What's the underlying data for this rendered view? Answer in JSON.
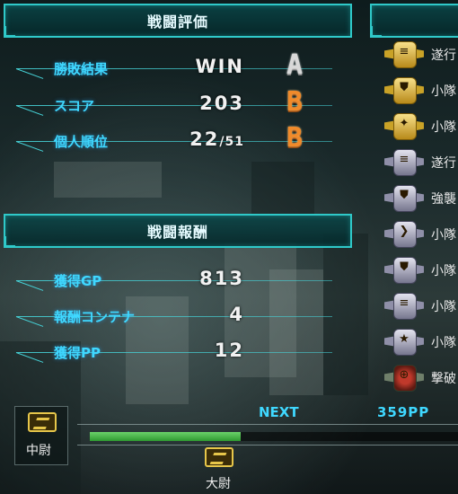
{
  "battle_evaluation": {
    "title": "戦闘評価",
    "rows": [
      {
        "label": "勝敗結果",
        "value": "WIN",
        "value_suffix": "",
        "grade": "A"
      },
      {
        "label": "スコア",
        "value": "203",
        "value_suffix": "",
        "grade": "B"
      },
      {
        "label": "個人順位",
        "value": "22",
        "value_suffix": "/51",
        "grade": "B"
      }
    ]
  },
  "battle_reward": {
    "title": "戦闘報酬",
    "rows": [
      {
        "label": "獲得GP",
        "value": "813"
      },
      {
        "label": "報酬コンテナ",
        "value": "4"
      },
      {
        "label": "獲得PP",
        "value": "12"
      }
    ]
  },
  "medals": [
    {
      "icon": "gold-document-medal-icon",
      "tier": "gold",
      "label": "遂行"
    },
    {
      "icon": "gold-shield-medal-icon",
      "tier": "gold",
      "label": "小隊"
    },
    {
      "icon": "gold-squad-medal-icon",
      "tier": "gold",
      "label": "小隊"
    },
    {
      "icon": "silver-document-medal-icon",
      "tier": "silver",
      "label": "遂行"
    },
    {
      "icon": "silver-shield-medal-icon",
      "tier": "silver",
      "label": "強襲"
    },
    {
      "icon": "silver-wing-medal-icon",
      "tier": "silver",
      "label": "小隊"
    },
    {
      "icon": "silver-shield-medal-icon",
      "tier": "silver",
      "label": "小隊"
    },
    {
      "icon": "silver-document-medal-icon",
      "tier": "silver",
      "label": "小隊"
    },
    {
      "icon": "silver-star-medal-icon",
      "tier": "silver",
      "label": "小隊"
    },
    {
      "icon": "red-target-medal-icon",
      "tier": "red",
      "label": "撃破"
    }
  ],
  "rank_progress": {
    "current_rank": "中尉",
    "next_rank": "大尉",
    "next_label": "NEXT",
    "pp_needed": "359PP",
    "progress_fraction": 0.41
  },
  "colors": {
    "accent_cyan": "#2fc9c9",
    "label_blue": "#3fd8ff",
    "grade_orange": "#f08a2a",
    "progress_green": "#4fbf4e"
  }
}
